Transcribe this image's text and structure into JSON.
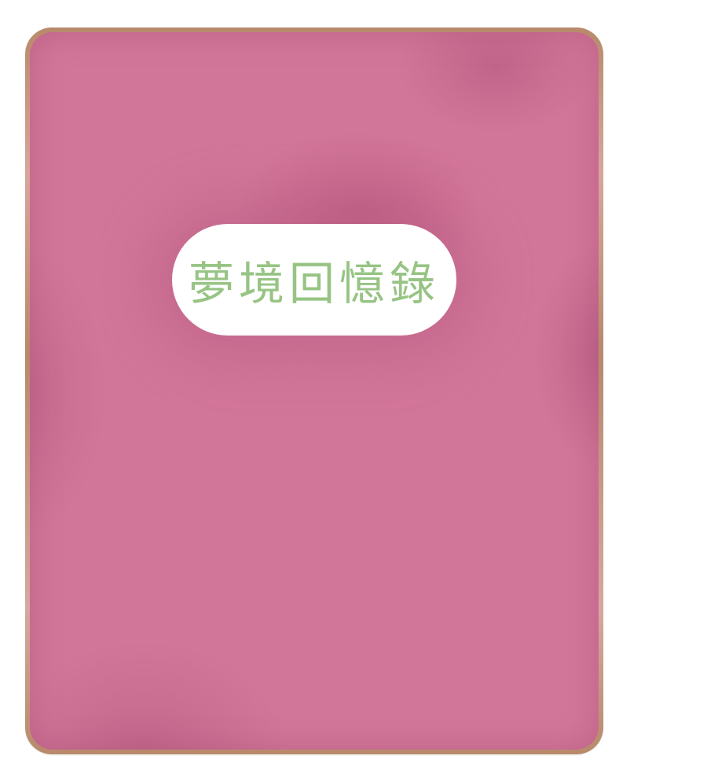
{
  "cover": {
    "title": "夢境回憶錄"
  },
  "colors": {
    "cover_pink": "#d27699",
    "frame_brown": "#b88a6a",
    "title_green": "#97c484",
    "plate_white": "#ffffff"
  }
}
